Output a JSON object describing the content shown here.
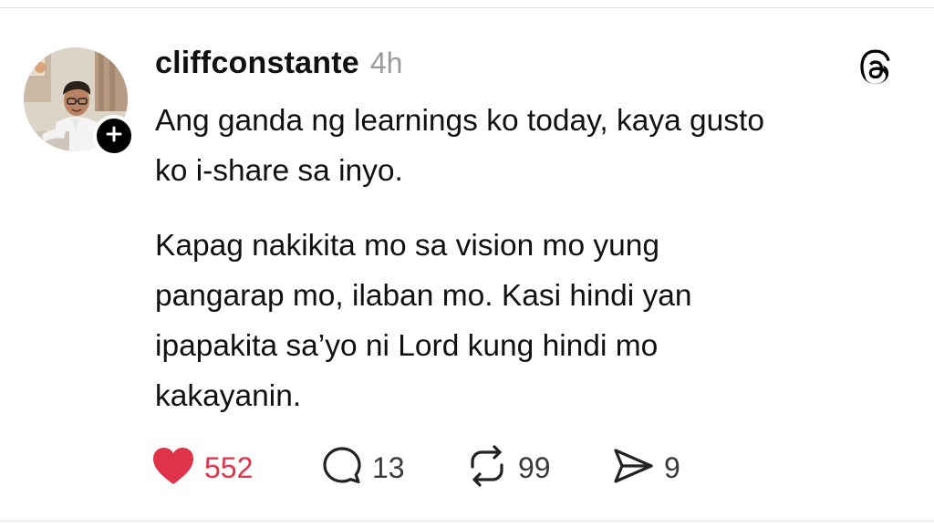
{
  "post": {
    "username": "cliffconstante",
    "timestamp": "4h",
    "paragraph1": [
      "Ang ganda ng learnings ko today, kaya gusto",
      "ko i-share sa inyo."
    ],
    "paragraph2": [
      "Kapag nakikita mo sa vision mo yung",
      "pangarap mo, ilaban mo. Kasi hindi yan",
      "ipapakita sa’yo ni Lord kung hindi mo",
      "kakayanin."
    ]
  },
  "actions": {
    "likes": "552",
    "replies": "13",
    "reposts": "99",
    "shares": "9"
  },
  "colors": {
    "like": "#e0334a",
    "text": "#111111",
    "muted": "#9b9b9b"
  },
  "icons": {
    "app": "threads-logo-icon",
    "follow": "plus-icon",
    "like": "heart-icon",
    "reply": "comment-bubble-icon",
    "repost": "repost-icon",
    "share": "send-icon"
  }
}
